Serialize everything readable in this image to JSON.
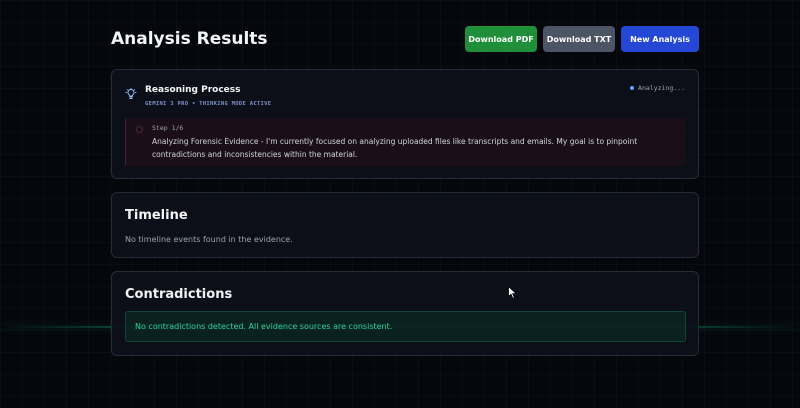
{
  "header": {
    "title": "Analysis Results",
    "download_pdf_label": "Download PDF",
    "download_txt_label": "Download TXT",
    "new_analysis_label": "New Analysis"
  },
  "reasoning": {
    "title": "Reasoning Process",
    "subtitle": "GEMINI 3 PRO • THINKING MODE ACTIVE",
    "status": "Analyzing...",
    "step": {
      "label": "Step 1/6",
      "text": "Analyzing Forensic Evidence - I'm currently focused on analyzing uploaded files like transcripts and emails. My goal is to pinpoint contradictions and inconsistencies within the material."
    }
  },
  "timeline": {
    "title": "Timeline",
    "empty_message": "No timeline events found in the evidence."
  },
  "contradictions": {
    "title": "Contradictions",
    "message": "No contradictions detected. All evidence sources are consistent."
  },
  "colors": {
    "background": "#06070c",
    "download_pdf": "#1f8f3a",
    "download_txt": "#4b5563",
    "new_analysis": "#2447d6",
    "success_text": "#34d399",
    "status_dot": "#60a5fa"
  },
  "icons": {
    "reasoning": "lightbulb-icon",
    "cursor": "mouse-pointer-icon"
  }
}
